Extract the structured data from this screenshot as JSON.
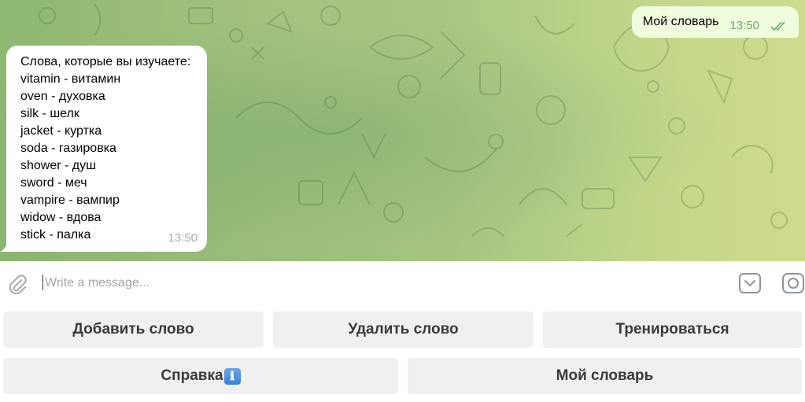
{
  "outgoing": {
    "text": "Мой словарь",
    "time": "13:50"
  },
  "incoming": {
    "lines": [
      "Слова, которые вы изучаете:",
      "vitamin - витамин",
      "oven - духовка",
      "silk - шелк",
      "jacket - куртка",
      "soda - газировка",
      "shower - душ",
      "sword - меч",
      "vampire - вампир",
      "widow - вдова",
      "stick - палка"
    ],
    "time": "13:50"
  },
  "composer": {
    "placeholder": "Write a message..."
  },
  "keyboard": {
    "row1": [
      "Добавить слово",
      "Удалить слово",
      "Тренироваться"
    ],
    "row2_help": "Справка",
    "row2_help_emoji": "ℹ",
    "row2_dict": "Мой словарь"
  },
  "colors": {
    "outgoing_bubble": "#effdde",
    "incoming_bubble": "#ffffff",
    "read_checks": "#6aa664",
    "button_bg": "#f0f0f0"
  },
  "icons": {
    "attach": "paperclip-icon",
    "keyboard": "bot-keyboard-icon",
    "camera": "instagram-camera-icon",
    "checks": "double-check-icon"
  }
}
